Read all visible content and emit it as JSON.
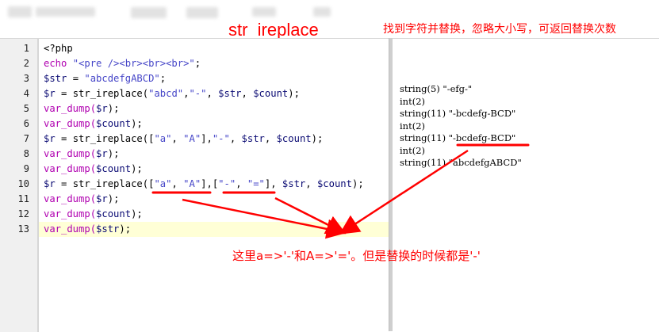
{
  "header": {
    "title": "str_ireplace",
    "note": "找到字符并替换，忽略大小写，可返回替换次数"
  },
  "editor": {
    "line_numbers": [
      "1",
      "2",
      "3",
      "4",
      "5",
      "6",
      "7",
      "8",
      "9",
      "10",
      "11",
      "12",
      "13"
    ],
    "lines": [
      [
        {
          "t": "<?php",
          "c": "fn"
        }
      ],
      [
        {
          "t": "echo ",
          "c": "kw"
        },
        {
          "t": "\"<pre /><br><br><br>\"",
          "c": "str"
        },
        {
          "t": ";",
          "c": "fn"
        }
      ],
      [
        {
          "t": "$str",
          "c": "var"
        },
        {
          "t": " = ",
          "c": "fn"
        },
        {
          "t": "\"abcdefgABCD\"",
          "c": "str"
        },
        {
          "t": ";",
          "c": "fn"
        }
      ],
      [
        {
          "t": "$r",
          "c": "var"
        },
        {
          "t": " = str_ireplace(",
          "c": "fn"
        },
        {
          "t": "\"abcd\"",
          "c": "str"
        },
        {
          "t": ",",
          "c": "fn"
        },
        {
          "t": "\"-\"",
          "c": "str"
        },
        {
          "t": ", ",
          "c": "fn"
        },
        {
          "t": "$str",
          "c": "var"
        },
        {
          "t": ", ",
          "c": "fn"
        },
        {
          "t": "$count",
          "c": "var"
        },
        {
          "t": ");",
          "c": "fn"
        }
      ],
      [
        {
          "t": "var_dump(",
          "c": "kw"
        },
        {
          "t": "$r",
          "c": "var"
        },
        {
          "t": ");",
          "c": "fn"
        }
      ],
      [
        {
          "t": "var_dump(",
          "c": "kw"
        },
        {
          "t": "$count",
          "c": "var"
        },
        {
          "t": ");",
          "c": "fn"
        }
      ],
      [
        {
          "t": "$r",
          "c": "var"
        },
        {
          "t": " = str_ireplace([",
          "c": "fn"
        },
        {
          "t": "\"a\"",
          "c": "str"
        },
        {
          "t": ", ",
          "c": "fn"
        },
        {
          "t": "\"A\"",
          "c": "str"
        },
        {
          "t": "],",
          "c": "fn"
        },
        {
          "t": "\"-\"",
          "c": "str"
        },
        {
          "t": ", ",
          "c": "fn"
        },
        {
          "t": "$str",
          "c": "var"
        },
        {
          "t": ", ",
          "c": "fn"
        },
        {
          "t": "$count",
          "c": "var"
        },
        {
          "t": ");",
          "c": "fn"
        }
      ],
      [
        {
          "t": "var_dump(",
          "c": "kw"
        },
        {
          "t": "$r",
          "c": "var"
        },
        {
          "t": ");",
          "c": "fn"
        }
      ],
      [
        {
          "t": "var_dump(",
          "c": "kw"
        },
        {
          "t": "$count",
          "c": "var"
        },
        {
          "t": ");",
          "c": "fn"
        }
      ],
      [
        {
          "t": "$r",
          "c": "var"
        },
        {
          "t": " = str_ireplace([",
          "c": "fn"
        },
        {
          "t": "\"a\"",
          "c": "str"
        },
        {
          "t": ", ",
          "c": "fn"
        },
        {
          "t": "\"A\"",
          "c": "str"
        },
        {
          "t": "],[",
          "c": "fn"
        },
        {
          "t": "\"-\"",
          "c": "str"
        },
        {
          "t": ", ",
          "c": "fn"
        },
        {
          "t": "\"=\"",
          "c": "str"
        },
        {
          "t": "], ",
          "c": "fn"
        },
        {
          "t": "$str",
          "c": "var"
        },
        {
          "t": ", ",
          "c": "fn"
        },
        {
          "t": "$count",
          "c": "var"
        },
        {
          "t": ");",
          "c": "fn"
        }
      ],
      [
        {
          "t": "var_dump(",
          "c": "kw"
        },
        {
          "t": "$r",
          "c": "var"
        },
        {
          "t": ");",
          "c": "fn"
        }
      ],
      [
        {
          "t": "var_dump(",
          "c": "kw"
        },
        {
          "t": "$count",
          "c": "var"
        },
        {
          "t": ");",
          "c": "fn"
        }
      ],
      [
        {
          "t": "var_dump(",
          "c": "kw"
        },
        {
          "t": "$str",
          "c": "var"
        },
        {
          "t": ");",
          "c": "fn"
        }
      ]
    ]
  },
  "output": {
    "lines": [
      "string(5) \"-efg-\"",
      "int(2)",
      "string(11) \"-bcdefg-BCD\"",
      "int(2)",
      "string(11) \"-bcdefg-BCD\"",
      "int(2)",
      "string(11) \"abcdefgABCD\""
    ]
  },
  "annotation": {
    "note": "这里a=>'-'和A=>'='。但是替换的时候都是'-'",
    "color": "#ff0000"
  }
}
